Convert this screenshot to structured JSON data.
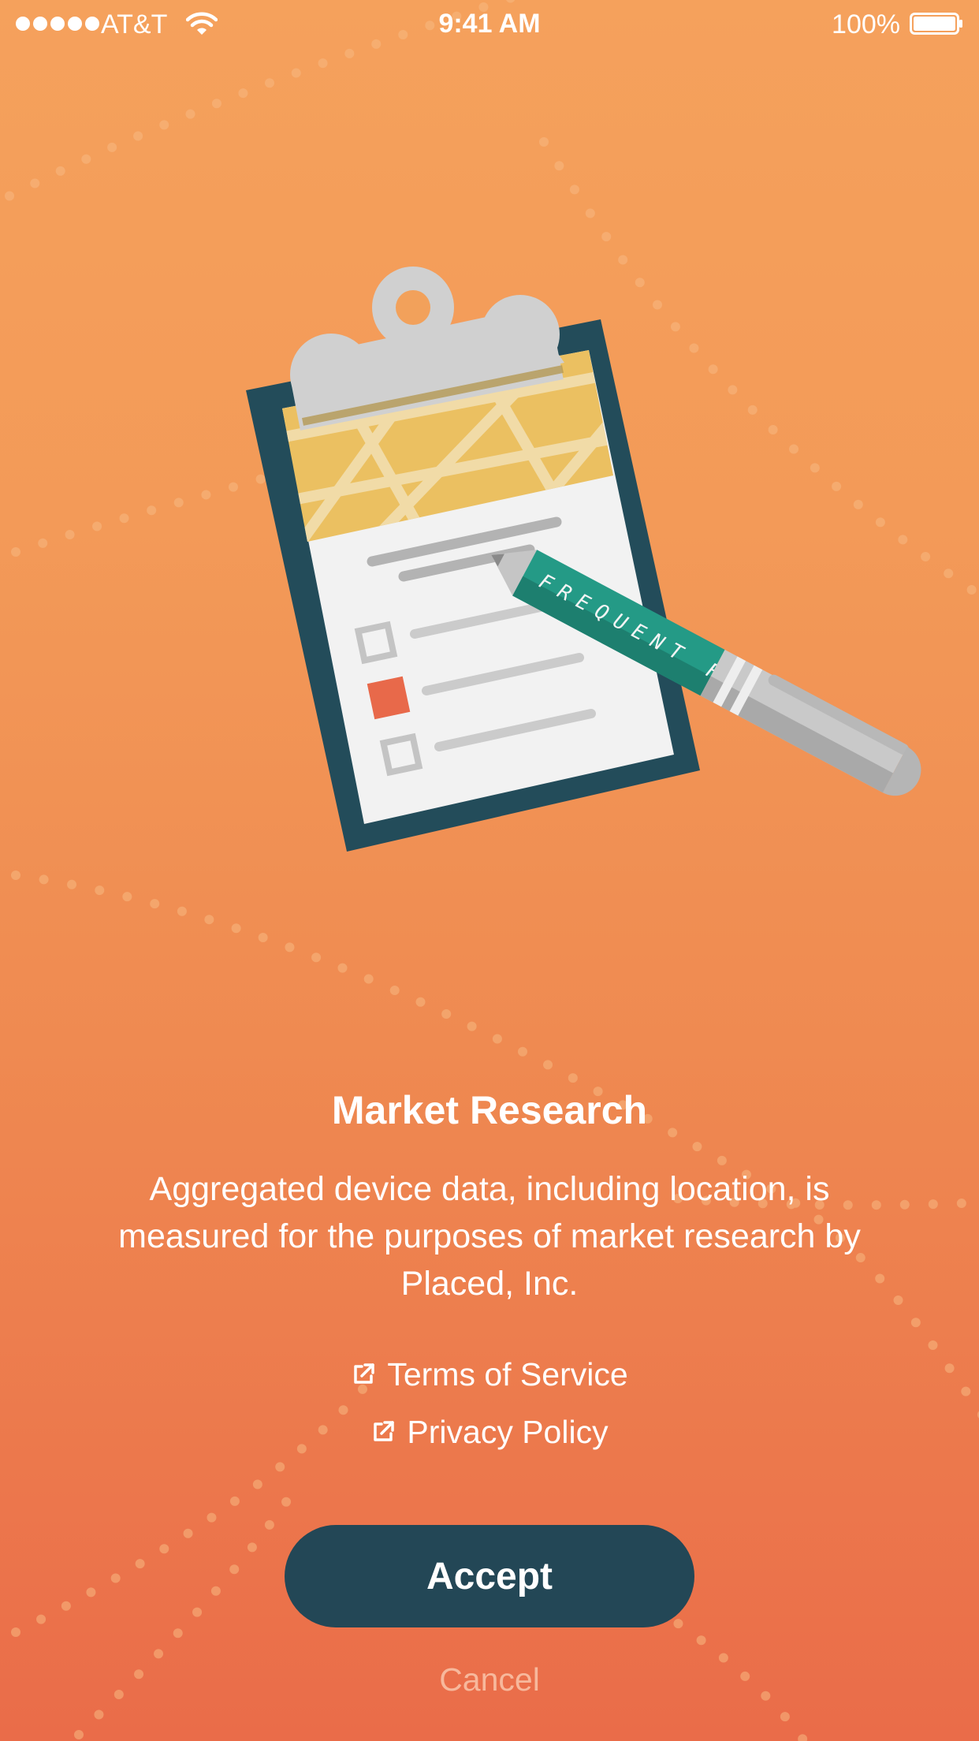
{
  "status_bar": {
    "carrier": "AT&T",
    "time": "9:41 AM",
    "battery": "100%",
    "signal_icon": "signal-dots-icon",
    "wifi_icon": "wifi-icon",
    "battery_icon": "battery-icon"
  },
  "illustration": {
    "name": "clipboard-with-pen-illustration",
    "pen_text": "FREQUENT F"
  },
  "content": {
    "title": "Market Research",
    "description": "Aggregated device data, including location, is measured for the purposes of market research by Placed, Inc."
  },
  "links": {
    "terms_label": "Terms of Service",
    "privacy_label": "Privacy Policy",
    "link_icon": "external-link-icon"
  },
  "actions": {
    "accept_label": "Accept",
    "cancel_label": "Cancel"
  },
  "colors": {
    "background_top": "#f5a15c",
    "background_bottom": "#ea6c49",
    "accept_button": "#234756",
    "cancel_text": "#f7b89c"
  }
}
